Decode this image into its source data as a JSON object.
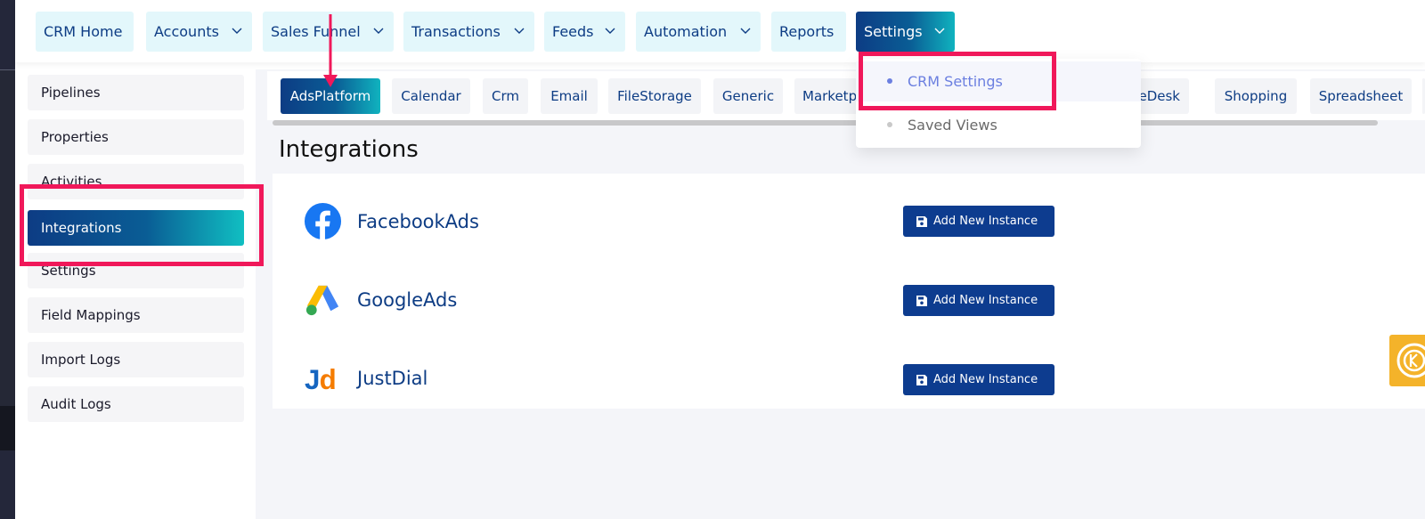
{
  "nav": {
    "items": [
      {
        "label": "CRM Home",
        "dropdown": false
      },
      {
        "label": "Accounts",
        "dropdown": true
      },
      {
        "label": "Sales Funnel",
        "dropdown": true
      },
      {
        "label": "Transactions",
        "dropdown": true
      },
      {
        "label": "Feeds",
        "dropdown": true
      },
      {
        "label": "Automation",
        "dropdown": true
      },
      {
        "label": "Reports",
        "dropdown": false
      },
      {
        "label": "Settings",
        "dropdown": true,
        "active": true
      }
    ]
  },
  "settings_menu": {
    "items": [
      {
        "label": "CRM Settings",
        "selected": true
      },
      {
        "label": "Saved Views",
        "selected": false
      }
    ]
  },
  "sidebar": {
    "items": [
      {
        "label": "Pipelines"
      },
      {
        "label": "Properties"
      },
      {
        "label": "Activities"
      },
      {
        "label": "Integrations",
        "active": true
      },
      {
        "label": "Settings"
      },
      {
        "label": "Field Mappings"
      },
      {
        "label": "Import Logs"
      },
      {
        "label": "Audit Logs"
      }
    ]
  },
  "tabs": {
    "items": [
      {
        "label": "AdsPlatform",
        "active": true
      },
      {
        "label": "Calendar"
      },
      {
        "label": "Crm"
      },
      {
        "label": "Email"
      },
      {
        "label": "FileStorage"
      },
      {
        "label": "Generic"
      },
      {
        "label": "Marketp"
      },
      {
        "label": "iceDesk"
      },
      {
        "label": "Shopping"
      },
      {
        "label": "Spreadsheet"
      }
    ]
  },
  "page": {
    "title": "Integrations"
  },
  "integrations": {
    "rows": [
      {
        "name": "FacebookAds",
        "action": "Add New Instance",
        "logo": "facebook-logo"
      },
      {
        "name": "GoogleAds",
        "action": "Add New Instance",
        "logo": "google-ads-logo"
      },
      {
        "name": "JustDial",
        "action": "Add New Instance",
        "logo": "justdial-logo"
      }
    ]
  },
  "icons": {
    "chevron": "chevron-down-icon",
    "save": "floppy-disk-icon"
  },
  "colors": {
    "brand_dark": "#0d3c84",
    "brand_teal": "#10b3bf",
    "highlight": "#f0185a",
    "nav_bg": "#e3f7fb",
    "menu_selected": "#6b7fe0"
  }
}
